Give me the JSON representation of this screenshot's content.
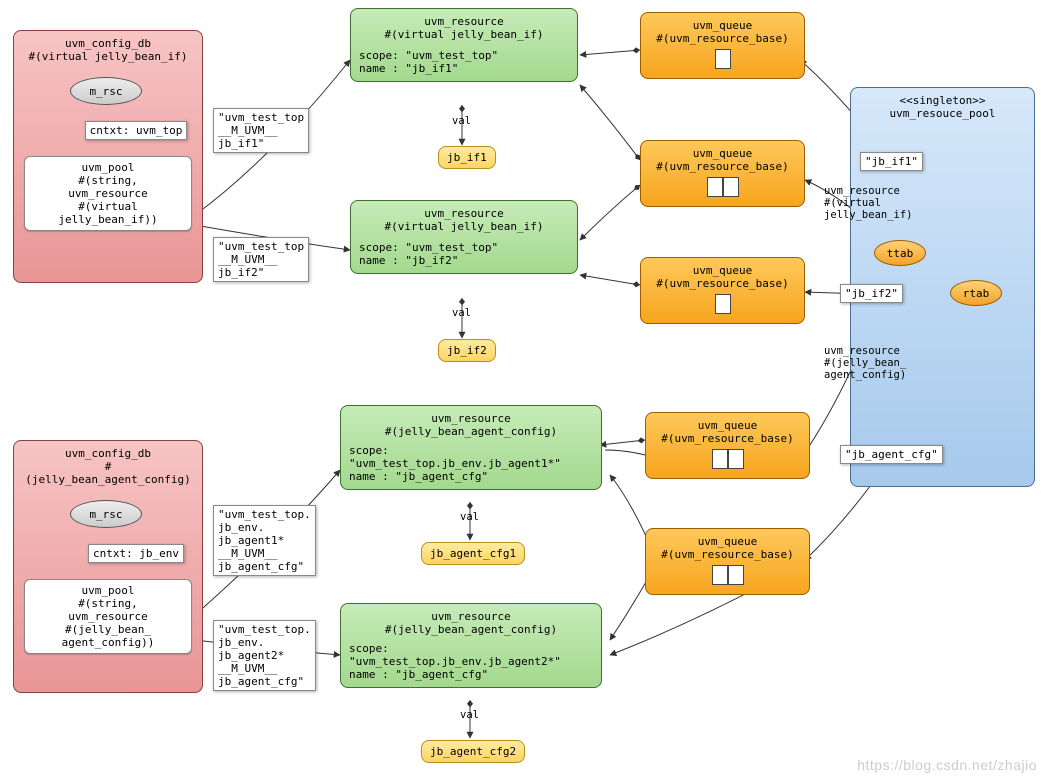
{
  "config1": {
    "title1": "uvm_config_db",
    "title2": "#(virtual jelly_bean_if)",
    "mrsc": "m_rsc",
    "cntxt": "cntxt: uvm_top",
    "pool1": "uvm_pool",
    "pool2": "#(string,",
    "pool3": "uvm_resource",
    "pool4": "#(virtual",
    "pool5": "jelly_bean_if))"
  },
  "config2": {
    "title1": "uvm_config_db",
    "title2": "#(jelly_bean_agent_config)",
    "mrsc": "m_rsc",
    "cntxt": "cntxt: jb_env",
    "pool1": "uvm_pool",
    "pool2": "#(string,",
    "pool3": "uvm_resource",
    "pool4": "#(jelly_bean_",
    "pool5": "agent_config))"
  },
  "edgelabel1": "\"uvm_test_top\n__M_UVM__\njb_if1\"",
  "edgelabel2": "\"uvm_test_top\n__M_UVM__\njb_if2\"",
  "edgelabel3": "\"uvm_test_top.\njb_env.\njb_agent1*\n__M_UVM__\njb_agent_cfg\"",
  "edgelabel4": "\"uvm_test_top.\njb_env.\njb_agent2*\n__M_UVM__\njb_agent_cfg\"",
  "res1": {
    "t1": "uvm_resource",
    "t2": "#(virtual jelly_bean_if)",
    "s": "scope: \"uvm_test_top\"",
    "n": "name : \"jb_if1\""
  },
  "res2": {
    "t1": "uvm_resource",
    "t2": "#(virtual jelly_bean_if)",
    "s": "scope: \"uvm_test_top\"",
    "n": "name : \"jb_if2\""
  },
  "res3": {
    "t1": "uvm_resource",
    "t2": "#(jelly_bean_agent_config)",
    "s1": "scope:",
    "s2": "\"uvm_test_top.jb_env.jb_agent1*\"",
    "n": "name : \"jb_agent_cfg\""
  },
  "res4": {
    "t1": "uvm_resource",
    "t2": "#(jelly_bean_agent_config)",
    "s1": "scope:",
    "s2": "\"uvm_test_top.jb_env.jb_agent2*\"",
    "n": "name : \"jb_agent_cfg\""
  },
  "val": "val",
  "jb_if1": "jb_if1",
  "jb_if2": "jb_if2",
  "jb_agent_cfg1": "jb_agent_cfg1",
  "jb_agent_cfg2": "jb_agent_cfg2",
  "queue": {
    "t1": "uvm_queue",
    "t2": "#(uvm_resource_base)"
  },
  "pool": {
    "stereo": "<<singleton>>",
    "name": "uvm_resouce_pool",
    "ttab": "ttab",
    "rtab": "rtab"
  },
  "jb_if1_lab": "\"jb_if1\"",
  "jb_if2_lab": "\"jb_if2\"",
  "jb_agent_cfg_lab": "\"jb_agent_cfg\"",
  "res_type1": "uvm_resource\n#(virtual\njelly_bean_if)",
  "res_type2": "uvm_resource\n#(jelly_bean_\nagent_config)",
  "watermark": "https://blog.csdn.net/zhajio"
}
